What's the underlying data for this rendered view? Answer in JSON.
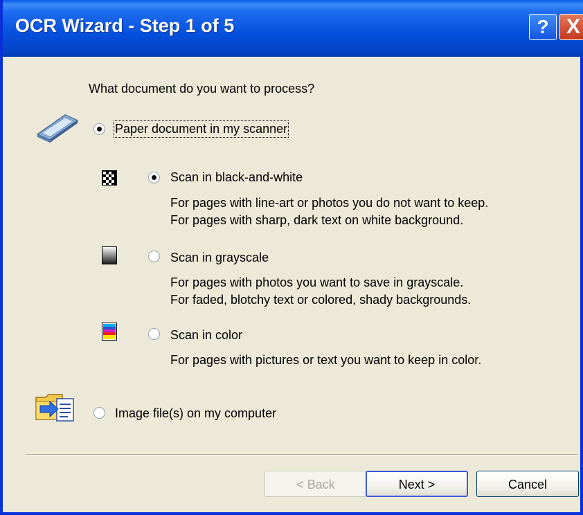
{
  "window": {
    "title": "OCR Wizard - Step 1 of 5",
    "help_label": "?",
    "close_label": "X"
  },
  "question": "What document do you want to process?",
  "options": {
    "paper": {
      "label": "Paper document in my scanner",
      "icon": "scanner-icon",
      "selected": true
    },
    "scan_bw": {
      "label": "Scan in black-and-white",
      "icon": "black-white-icon",
      "selected": true,
      "desc1": "For pages with line-art or photos you do not want to keep.",
      "desc2": "For pages with sharp, dark text on white background."
    },
    "scan_gray": {
      "label": "Scan in grayscale",
      "icon": "grayscale-icon",
      "selected": false,
      "desc1": "For pages with photos you want to save in grayscale.",
      "desc2": "For faded, blotchy text or colored, shady backgrounds."
    },
    "scan_color": {
      "label": "Scan in color",
      "icon": "color-icon",
      "selected": false,
      "desc1": "For pages with pictures or text you want to keep in color."
    },
    "image_files": {
      "label": "Image file(s) on my computer",
      "icon": "folder-import-icon",
      "selected": false
    }
  },
  "buttons": {
    "back": "< Back",
    "next": "Next >",
    "cancel": "Cancel"
  },
  "colors": {
    "titlebar": "#0550DC",
    "dialog_bg": "#ECE9D8",
    "close_red": "#C4381C"
  }
}
